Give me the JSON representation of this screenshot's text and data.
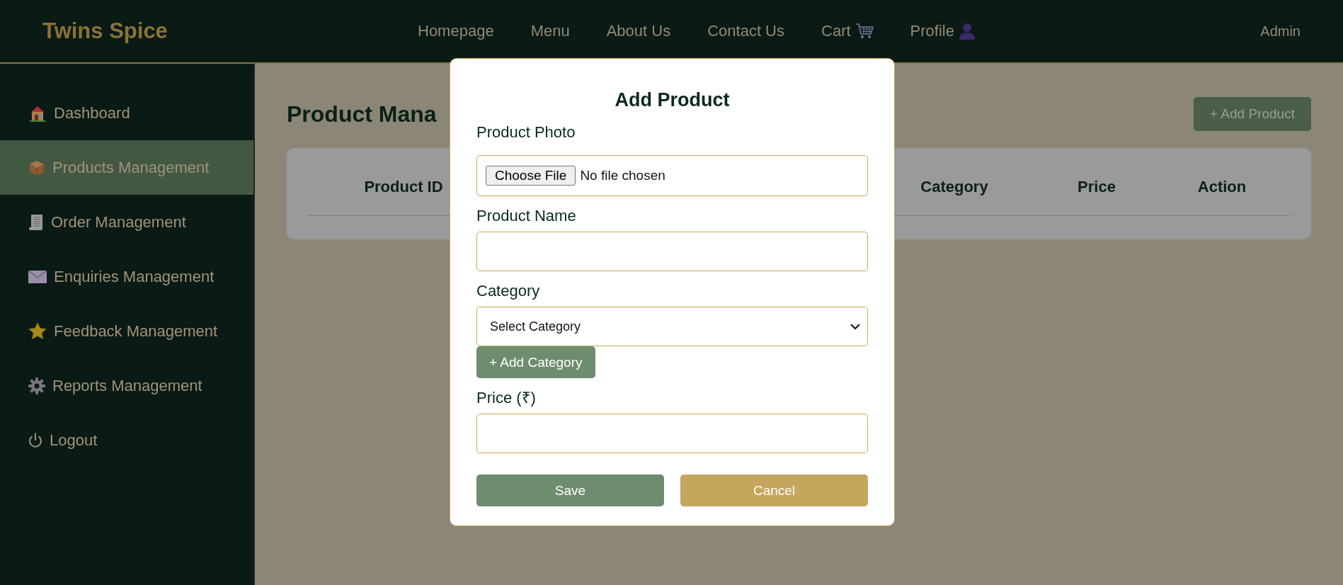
{
  "header": {
    "logo": "Twins Spice",
    "nav": [
      {
        "label": "Homepage"
      },
      {
        "label": "Menu"
      },
      {
        "label": "About Us"
      },
      {
        "label": "Contact Us"
      },
      {
        "label": "Cart"
      },
      {
        "label": "Profile"
      }
    ],
    "user": "Admin"
  },
  "sidebar": {
    "items": [
      {
        "label": "Dashboard",
        "selected": false
      },
      {
        "label": "Products Management",
        "selected": true
      },
      {
        "label": "Order Management",
        "selected": false
      },
      {
        "label": "Enquiries Management",
        "selected": false
      },
      {
        "label": "Feedback Management",
        "selected": false
      },
      {
        "label": "Reports Management",
        "selected": false
      },
      {
        "label": "Logout",
        "selected": false
      }
    ]
  },
  "main": {
    "title": "Product Mana",
    "add_button": "+ Add Product",
    "table": {
      "columns": [
        "Product ID",
        "Category",
        "Price",
        "Action"
      ]
    }
  },
  "modal": {
    "title": "Add Product",
    "fields": [
      {
        "kind": "file",
        "label": "Product Photo",
        "button": "Choose File",
        "status": "No file chosen"
      },
      {
        "kind": "text",
        "label": "Product Name"
      },
      {
        "kind": "select",
        "label": "Category",
        "value": "Select Category",
        "action": "+ Add Category"
      },
      {
        "kind": "text",
        "label": "Price (₹)"
      }
    ],
    "buttons": [
      {
        "kind": "primary",
        "label": "Save"
      },
      {
        "kind": "secondary",
        "label": "Cancel"
      }
    ]
  }
}
